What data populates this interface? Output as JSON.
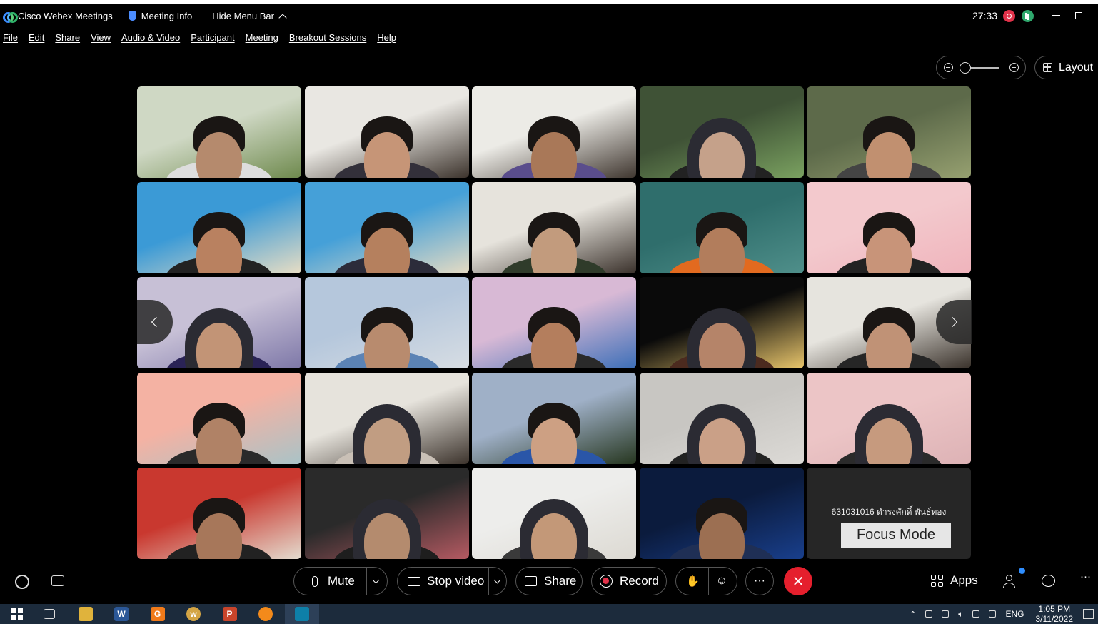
{
  "title_bar": {
    "app_name": "Cisco Webex Meetings",
    "meeting_info": "Meeting Info",
    "hide_menu_bar": "Hide Menu Bar",
    "timer": "27:33"
  },
  "menu": [
    "File",
    "Edit",
    "Share",
    "View",
    "Audio & Video",
    "Participant",
    "Meeting",
    "Breakout Sessions",
    "Help"
  ],
  "view_controls": {
    "layout_label": "Layout"
  },
  "grid": {
    "tiles": [
      {
        "bg": "#cfd8c4",
        "bg2": "#6f8a4e",
        "style": "hair",
        "skin": "#b58a6d",
        "shirt": "#ddd"
      },
      {
        "bg": "#e9e7e2",
        "bg2": "#3d342d",
        "style": "hair",
        "skin": "#c69577",
        "shirt": "#33303a"
      },
      {
        "bg": "#ecebe6",
        "bg2": "#403730",
        "style": "hair",
        "skin": "#a97858",
        "shirt": "#5a4d8c"
      },
      {
        "bg": "#3f5236",
        "bg2": "#7aa160",
        "style": "hijab",
        "skin": "#c5a18a",
        "shirt": "#222"
      },
      {
        "bg": "#5d6a4a",
        "bg2": "#96a070",
        "style": "hair",
        "skin": "#c19070",
        "shirt": "#444"
      },
      {
        "bg": "#3b9ad6",
        "bg2": "#e7ddc4",
        "style": "hair",
        "skin": "#b98160",
        "shirt": "#222"
      },
      {
        "bg": "#45a0d8",
        "bg2": "#e5dbc3",
        "style": "hair",
        "skin": "#b5805e",
        "shirt": "#2c2c3a"
      },
      {
        "bg": "#e6e3dc",
        "bg2": "#3a312b",
        "style": "hair",
        "skin": "#c29b7d",
        "shirt": "#2f3b2a"
      },
      {
        "bg": "#2f6e6c",
        "bg2": "#4f8f8a",
        "style": "hair",
        "skin": "#b27d5c",
        "shirt": "#e26a1f"
      },
      {
        "bg": "#f3c9cd",
        "bg2": "#f0b4bc",
        "style": "hair",
        "skin": "#c89479",
        "shirt": "#222"
      },
      {
        "bg": "#c7c0d6",
        "bg2": "#7e78a8",
        "style": "hijab",
        "skin": "#c29476",
        "shirt": "#2a2356"
      },
      {
        "bg": "#b5c7dc",
        "bg2": "#d7dde3",
        "style": "hair",
        "skin": "#b88b6e",
        "shirt": "#5b83b5"
      },
      {
        "bg": "#d8b9d5",
        "bg2": "#3d6fb8",
        "style": "hair",
        "skin": "#b47e5d",
        "shirt": "#2a2a2a"
      },
      {
        "bg": "#0a0a0a",
        "bg2": "#e8c56b",
        "style": "hijab",
        "skin": "#b58469",
        "shirt": "#4b2a1f"
      },
      {
        "bg": "#e6e4de",
        "bg2": "#3a322b",
        "style": "hair",
        "skin": "#c09276",
        "shirt": "#262626"
      },
      {
        "bg": "#f4b2a3",
        "bg2": "#a9c3c7",
        "style": "hair",
        "skin": "#b08266",
        "shirt": "#2a2a2a"
      },
      {
        "bg": "#e6e3dc",
        "bg2": "#3c332c",
        "style": "hijab",
        "skin": "#c19d82",
        "shirt": "#c9c0b6"
      },
      {
        "bg": "#9fb0c7",
        "bg2": "#26361f",
        "style": "hair",
        "skin": "#cda083",
        "shirt": "#2a56a8"
      },
      {
        "bg": "#c8c6c2",
        "bg2": "#dcdad6",
        "style": "hijab",
        "skin": "#caa087",
        "shirt": "#222"
      },
      {
        "bg": "#ecc5c6",
        "bg2": "#ddb2b5",
        "style": "hijab",
        "skin": "#c69a7e",
        "shirt": "#2a2a2a"
      },
      {
        "bg": "#c9382f",
        "bg2": "#e4dccf",
        "style": "hair",
        "skin": "#a7775a",
        "shirt": "#222"
      },
      {
        "bg": "#2a2a2a",
        "bg2": "#b55a62",
        "style": "hijab",
        "skin": "#b48b6e",
        "shirt": "#1e1e1e"
      },
      {
        "bg": "#ededeb",
        "bg2": "#dcd9d2",
        "style": "hijab",
        "skin": "#c39878",
        "shirt": "#3a3a3a"
      },
      {
        "bg": "#0b1b3d",
        "bg2": "#193f8c",
        "style": "hair",
        "skin": "#9c6f52",
        "shirt": "#1f2f55"
      }
    ],
    "name_tile": {
      "participant_name": "631031016 ดำรงศักดิ์ พันธ์ทอง",
      "focus_mode": "Focus Mode"
    }
  },
  "controls": {
    "mute": "Mute",
    "stop_video": "Stop video",
    "share": "Share",
    "record": "Record",
    "more": "···",
    "apps": "Apps"
  },
  "taskbar": {
    "apps": [
      {
        "name": "task-view",
        "label": "",
        "color": "#1c2b3c"
      },
      {
        "name": "file-explorer",
        "label": "",
        "color": "#e0b33c"
      },
      {
        "name": "word",
        "label": "W",
        "color": "#2b5797"
      },
      {
        "name": "app-orange",
        "label": "G",
        "color": "#f07a1a"
      },
      {
        "name": "app-w",
        "label": "w",
        "color": "#d4a545"
      },
      {
        "name": "powerpoint",
        "label": "P",
        "color": "#c8442b"
      },
      {
        "name": "firefox",
        "label": "",
        "color": "#f38a1b"
      },
      {
        "name": "webex",
        "label": "",
        "color": "#0e7fa8"
      }
    ],
    "lang": "ENG",
    "time": "1:05 PM",
    "date": "3/11/2022"
  }
}
